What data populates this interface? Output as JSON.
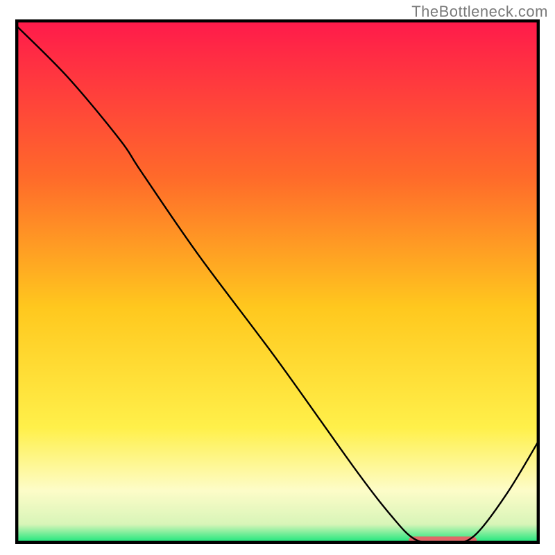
{
  "watermark": "TheBottleneck.com",
  "chart_data": {
    "type": "line",
    "title": "",
    "xlabel": "",
    "ylabel": "",
    "xlim": [
      0,
      100
    ],
    "ylim": [
      0,
      100
    ],
    "grid": false,
    "legend": false,
    "background_gradient": {
      "stops": [
        {
          "offset": 0.0,
          "color": "#ff1a4b"
        },
        {
          "offset": 0.3,
          "color": "#ff6a2a"
        },
        {
          "offset": 0.55,
          "color": "#ffc81e"
        },
        {
          "offset": 0.78,
          "color": "#fff04a"
        },
        {
          "offset": 0.9,
          "color": "#fdfcc8"
        },
        {
          "offset": 0.965,
          "color": "#d8f5b8"
        },
        {
          "offset": 1.0,
          "color": "#17e67a"
        }
      ]
    },
    "series": [
      {
        "name": "curve",
        "color": "#000000",
        "width": 2.4,
        "points": [
          {
            "x": 0,
            "y": 99
          },
          {
            "x": 10,
            "y": 89
          },
          {
            "x": 20,
            "y": 77
          },
          {
            "x": 24,
            "y": 71
          },
          {
            "x": 35,
            "y": 55
          },
          {
            "x": 50,
            "y": 35
          },
          {
            "x": 65,
            "y": 14
          },
          {
            "x": 72,
            "y": 5
          },
          {
            "x": 76,
            "y": 1
          },
          {
            "x": 80,
            "y": 0
          },
          {
            "x": 84,
            "y": 0
          },
          {
            "x": 88,
            "y": 2
          },
          {
            "x": 94,
            "y": 10
          },
          {
            "x": 100,
            "y": 20
          }
        ]
      }
    ],
    "highlight_bar": {
      "color": "#e06868",
      "x_start": 75,
      "x_end": 88,
      "thickness_pct": 1.6,
      "y_center_pct": 0.6
    },
    "frame": {
      "color": "#000000",
      "width": 5
    }
  }
}
